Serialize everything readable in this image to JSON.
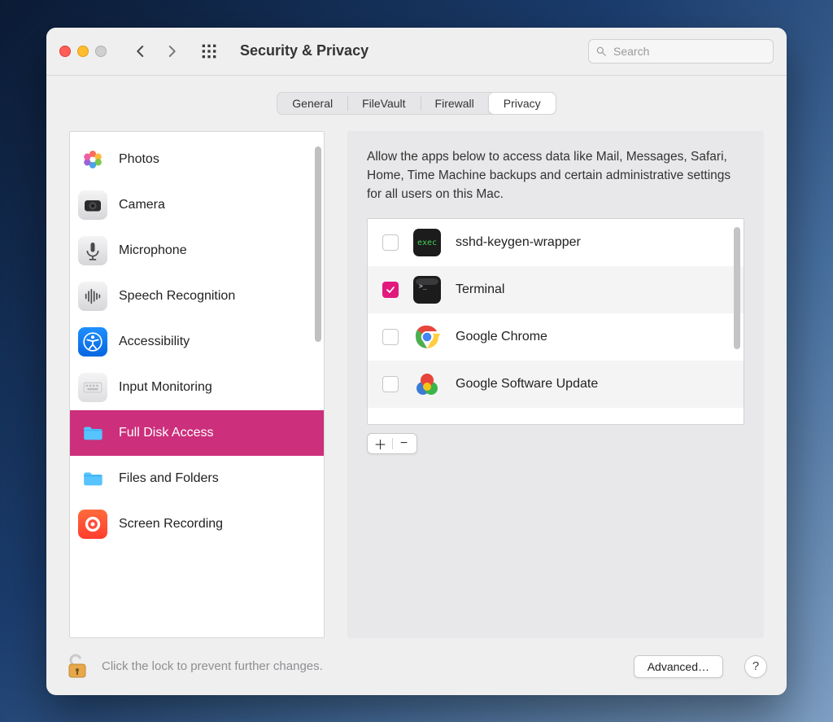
{
  "window": {
    "title": "Security & Privacy"
  },
  "toolbar": {
    "search_placeholder": "Search"
  },
  "tabs": [
    {
      "label": "General",
      "active": false
    },
    {
      "label": "FileVault",
      "active": false
    },
    {
      "label": "Firewall",
      "active": false
    },
    {
      "label": "Privacy",
      "active": true
    }
  ],
  "sidebar": {
    "items": [
      {
        "label": "Photos",
        "icon": "photos",
        "selected": false
      },
      {
        "label": "Camera",
        "icon": "camera",
        "selected": false
      },
      {
        "label": "Microphone",
        "icon": "microphone",
        "selected": false
      },
      {
        "label": "Speech Recognition",
        "icon": "speech",
        "selected": false
      },
      {
        "label": "Accessibility",
        "icon": "accessibility",
        "selected": false
      },
      {
        "label": "Input Monitoring",
        "icon": "keyboard",
        "selected": false
      },
      {
        "label": "Full Disk Access",
        "icon": "folder",
        "selected": true
      },
      {
        "label": "Files and Folders",
        "icon": "folder",
        "selected": false
      },
      {
        "label": "Screen Recording",
        "icon": "target",
        "selected": false
      }
    ]
  },
  "description": "Allow the apps below to access data like Mail, Messages, Safari, Home, Time Machine backups and certain administrative settings for all users on this Mac.",
  "apps": [
    {
      "label": "sshd-keygen-wrapper",
      "icon": "exec",
      "checked": false
    },
    {
      "label": "Terminal",
      "icon": "terminal",
      "checked": true
    },
    {
      "label": "Google Chrome",
      "icon": "chrome",
      "checked": false
    },
    {
      "label": "Google Software Update",
      "icon": "balls",
      "checked": false
    }
  ],
  "footer": {
    "lock_text": "Click the lock to prevent further changes.",
    "advanced_label": "Advanced…",
    "help_label": "?"
  },
  "colors": {
    "accent": "#cc2f7b",
    "checkbox": "#e2197c"
  }
}
